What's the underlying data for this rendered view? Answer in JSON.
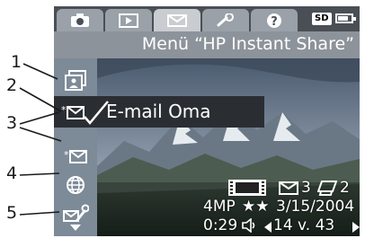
{
  "callouts": [
    "1",
    "2",
    "3",
    "4",
    "5"
  ],
  "tabs": [
    {
      "icon": "camera-icon"
    },
    {
      "icon": "playback-icon"
    },
    {
      "icon": "envelope-icon",
      "active": true
    },
    {
      "icon": "wrench-icon"
    },
    {
      "icon": "help-icon"
    }
  ],
  "status": {
    "card_label": "SD",
    "battery_level": 0.75
  },
  "header": {
    "title": "Menü “HP Instant Share”"
  },
  "sidebar": {
    "items": [
      {
        "icon": "print-icon"
      },
      {
        "icon": "email-destination-icon",
        "selected": true
      },
      {
        "icon": "email-icon"
      },
      {
        "icon": "web-icon"
      },
      {
        "icon": "setup-icon"
      }
    ],
    "scroll_icon": "scroll-down-icon"
  },
  "menu": {
    "selected_label": "E-mail Oma"
  },
  "photo_info": {
    "email_count": "3",
    "print_count": "2",
    "resolution": "4MP",
    "stars": "★★",
    "date": "3/15/2004",
    "duration": "0:29",
    "position": "14 v. 43"
  },
  "colors": {
    "highlight": "#2a2e33",
    "tab_active": "#c9ccd0",
    "title_bar": "#8d939a"
  }
}
